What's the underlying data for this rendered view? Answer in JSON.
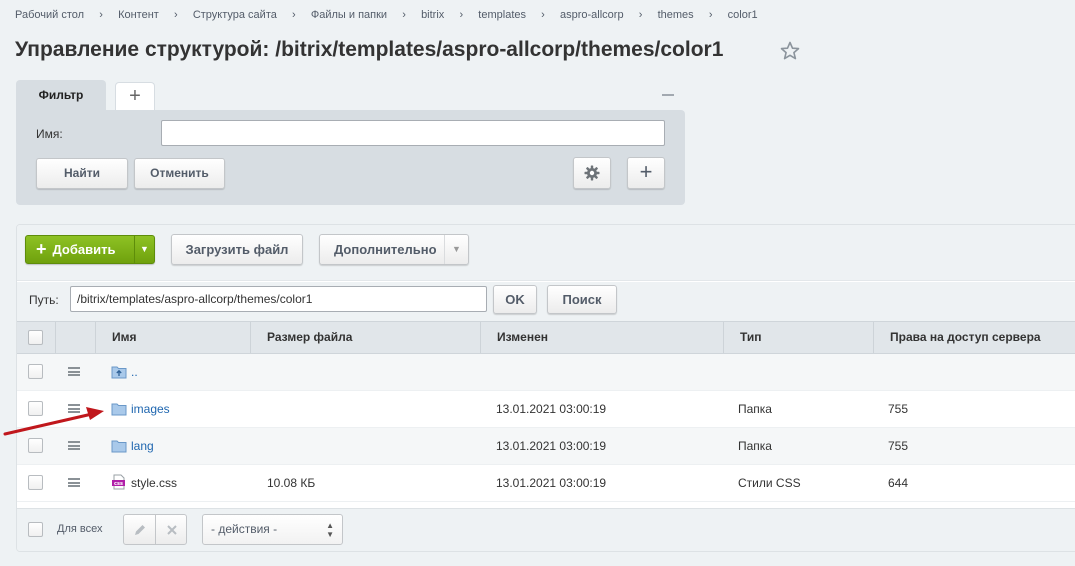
{
  "breadcrumb": [
    "Рабочий стол",
    "Контент",
    "Структура сайта",
    "Файлы и папки",
    "bitrix",
    "templates",
    "aspro-allcorp",
    "themes",
    "color1"
  ],
  "page_title": "Управление структурой: /bitrix/templates/aspro-allcorp/themes/color1",
  "filter": {
    "tab_label": "Фильтр",
    "name_label": "Имя:",
    "name_value": "",
    "find_label": "Найти",
    "cancel_label": "Отменить"
  },
  "toolbar": {
    "add_label": "Добавить",
    "upload_label": "Загрузить файл",
    "more_label": "Дополнительно"
  },
  "path": {
    "label": "Путь:",
    "value": "/bitrix/templates/aspro-allcorp/themes/color1",
    "ok_label": "OK",
    "search_label": "Поиск"
  },
  "columns": [
    "Имя",
    "Размер файла",
    "Изменен",
    "Тип",
    "Права на доступ сервера"
  ],
  "rows": [
    {
      "name": "..",
      "size": "",
      "modified": "",
      "type": "",
      "perms": "",
      "icon": "folder-up-icon"
    },
    {
      "name": "images",
      "size": "",
      "modified": "13.01.2021 03:00:19",
      "type": "Папка",
      "perms": "755",
      "icon": "folder-icon"
    },
    {
      "name": "lang",
      "size": "",
      "modified": "13.01.2021 03:00:19",
      "type": "Папка",
      "perms": "755",
      "icon": "folder-icon"
    },
    {
      "name": "style.css",
      "size": "10.08 КБ",
      "modified": "13.01.2021 03:00:19",
      "type": "Стили CSS",
      "perms": "644",
      "icon": "css-file-icon"
    }
  ],
  "footer": {
    "for_all_label": "Для всех",
    "actions_value": "- действия -"
  },
  "colors": {
    "accent_green": "#7bb21a",
    "link": "#2067b0",
    "annotation_arrow": "#c0171c"
  }
}
